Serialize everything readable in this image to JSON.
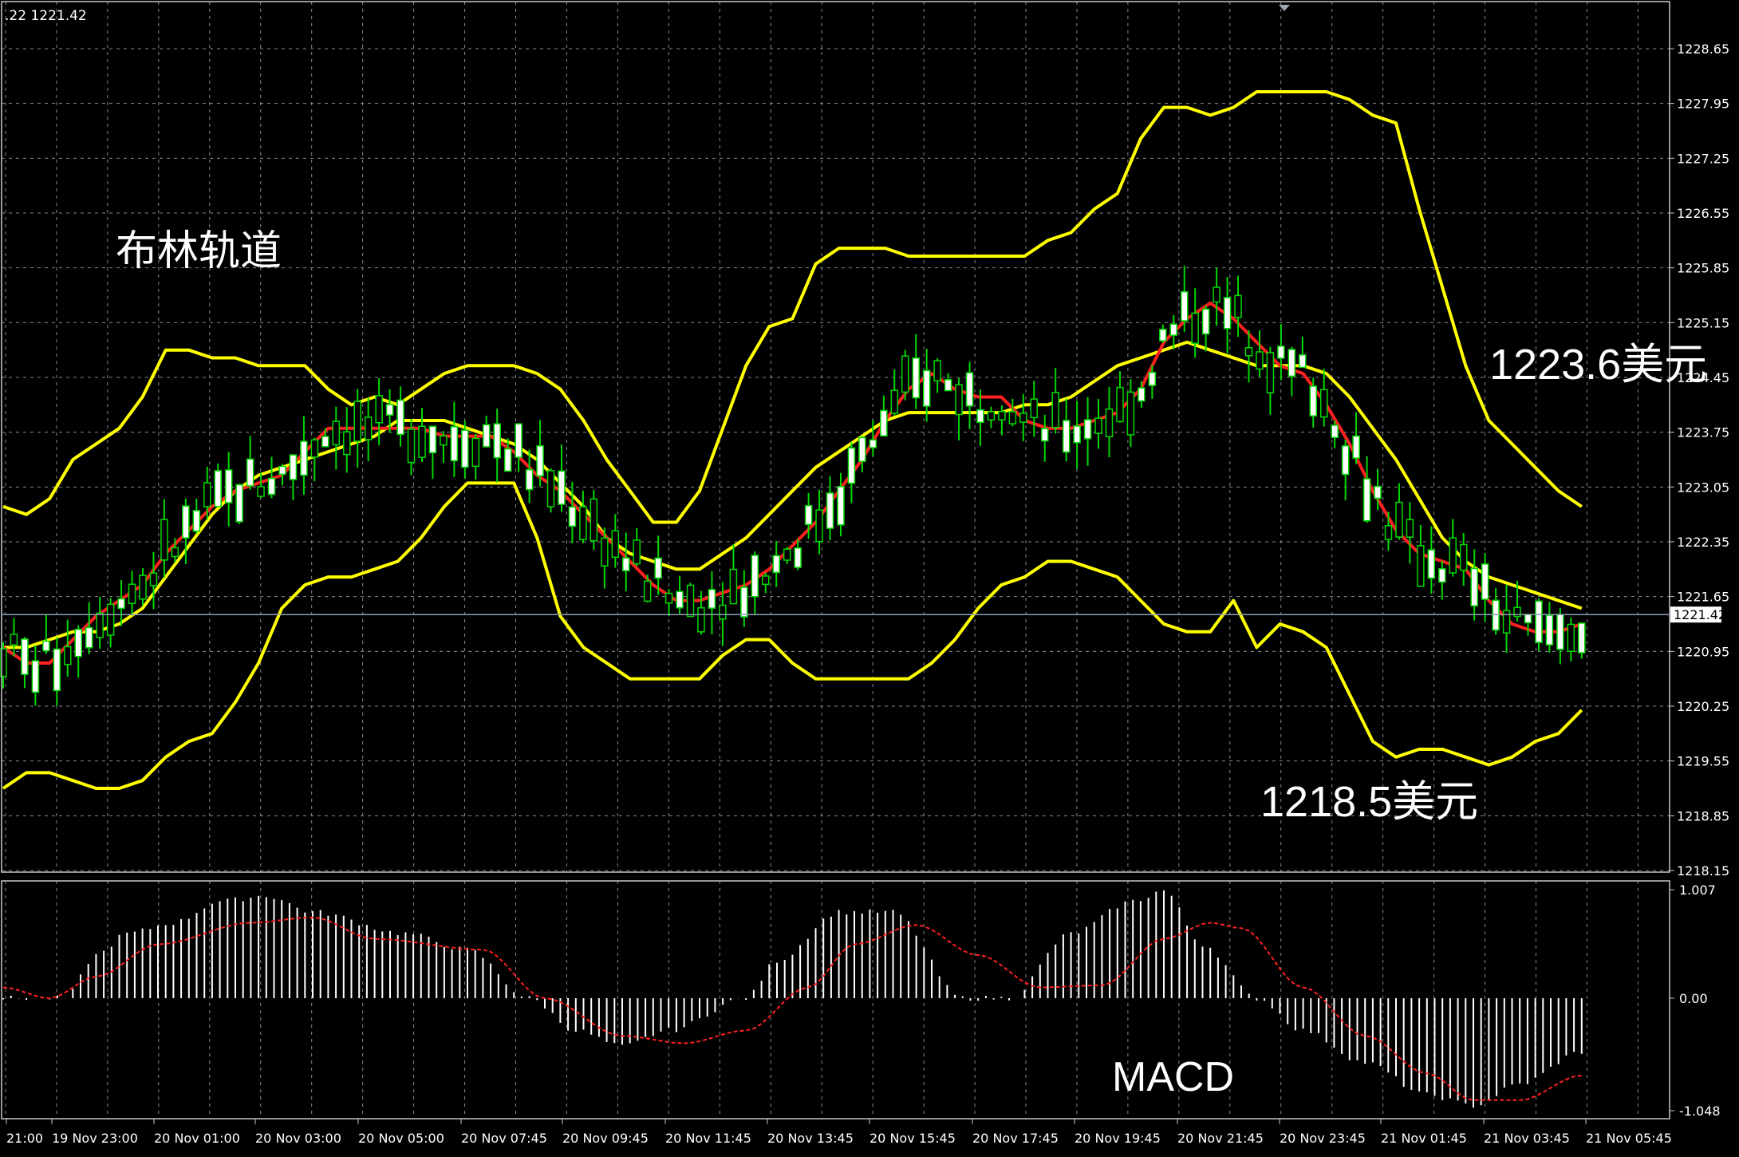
{
  "header": {
    "info": ".22 1221.42"
  },
  "annotations": {
    "title": "布林轨道",
    "upper": "1223.6美元",
    "lower": "1218.5美元",
    "macd": "MACD"
  },
  "colors": {
    "background": "#000000",
    "grid": "#8a8a8a",
    "candle": "#00d800",
    "bollinger": "#ffff00",
    "moving_average": "#ff2020",
    "macd_histogram": "#ffffff",
    "macd_signal": "#ff2020",
    "current_price_line": "#8ea0b4"
  },
  "chart_data": [
    {
      "type": "candlestick",
      "name": "price",
      "ylim": [
        1218.15,
        1228.65
      ],
      "y_ticks": [
        "1228.65",
        "1227.95",
        "1227.25",
        "1226.55",
        "1225.85",
        "1225.15",
        "1224.45",
        "1223.75",
        "1223.05",
        "1222.35",
        "1221.65",
        "1220.95",
        "1220.25",
        "1219.55",
        "1218.85",
        "1218.15"
      ],
      "current_price": "1221.42",
      "x_labels": [
        "21:00",
        "19 Nov 23:00",
        "20 Nov 01:00",
        "20 Nov 03:00",
        "20 Nov 05:00",
        "20 Nov 07:45",
        "20 Nov 09:45",
        "20 Nov 11:45",
        "20 Nov 13:45",
        "20 Nov 15:45",
        "20 Nov 17:45",
        "20 Nov 19:45",
        "20 Nov 21:45",
        "20 Nov 23:45",
        "21 Nov 01:45",
        "21 Nov 03:45",
        "21 Nov 05:45"
      ],
      "grid": true,
      "bollinger_upper": [
        [
          0,
          1222.8
        ],
        [
          3,
          1222.7
        ],
        [
          6,
          1222.9
        ],
        [
          9,
          1223.4
        ],
        [
          12,
          1223.6
        ],
        [
          15,
          1223.8
        ],
        [
          18,
          1224.2
        ],
        [
          21,
          1224.8
        ],
        [
          24,
          1224.8
        ],
        [
          27,
          1224.7
        ],
        [
          30,
          1224.7
        ],
        [
          33,
          1224.6
        ],
        [
          36,
          1224.6
        ],
        [
          39,
          1224.6
        ],
        [
          42,
          1224.3
        ],
        [
          45,
          1224.1
        ],
        [
          48,
          1224.2
        ],
        [
          51,
          1224.1
        ],
        [
          54,
          1224.3
        ],
        [
          57,
          1224.5
        ],
        [
          60,
          1224.6
        ],
        [
          63,
          1224.6
        ],
        [
          66,
          1224.6
        ],
        [
          69,
          1224.5
        ],
        [
          72,
          1224.3
        ],
        [
          75,
          1223.9
        ],
        [
          78,
          1223.4
        ],
        [
          81,
          1223.0
        ],
        [
          84,
          1222.6
        ],
        [
          87,
          1222.6
        ],
        [
          90,
          1223.0
        ],
        [
          93,
          1223.8
        ],
        [
          96,
          1224.6
        ],
        [
          99,
          1225.1
        ],
        [
          102,
          1225.2
        ],
        [
          105,
          1225.9
        ],
        [
          108,
          1226.1
        ],
        [
          111,
          1226.1
        ],
        [
          114,
          1226.1
        ],
        [
          117,
          1226.0
        ],
        [
          120,
          1226.0
        ],
        [
          123,
          1226.0
        ],
        [
          126,
          1226.0
        ],
        [
          129,
          1226.0
        ],
        [
          132,
          1226.0
        ],
        [
          135,
          1226.2
        ],
        [
          138,
          1226.3
        ],
        [
          141,
          1226.6
        ],
        [
          144,
          1226.8
        ],
        [
          147,
          1227.5
        ],
        [
          150,
          1227.9
        ],
        [
          153,
          1227.9
        ],
        [
          156,
          1227.8
        ],
        [
          159,
          1227.9
        ],
        [
          162,
          1228.1
        ],
        [
          165,
          1228.1
        ],
        [
          168,
          1228.1
        ],
        [
          171,
          1228.1
        ],
        [
          174,
          1228.0
        ],
        [
          177,
          1227.8
        ],
        [
          180,
          1227.7
        ],
        [
          183,
          1226.6
        ],
        [
          186,
          1225.6
        ],
        [
          189,
          1224.6
        ],
        [
          192,
          1223.9
        ],
        [
          195,
          1223.6
        ],
        [
          198,
          1223.3
        ],
        [
          201,
          1223.0
        ],
        [
          204,
          1222.8
        ]
      ],
      "bollinger_middle": [
        [
          0,
          1221.0
        ],
        [
          3,
          1221.0
        ],
        [
          6,
          1221.1
        ],
        [
          9,
          1221.2
        ],
        [
          12,
          1221.2
        ],
        [
          15,
          1221.3
        ],
        [
          18,
          1221.5
        ],
        [
          21,
          1221.9
        ],
        [
          24,
          1222.3
        ],
        [
          27,
          1222.7
        ],
        [
          30,
          1223.0
        ],
        [
          33,
          1223.2
        ],
        [
          36,
          1223.3
        ],
        [
          39,
          1223.4
        ],
        [
          42,
          1223.5
        ],
        [
          45,
          1223.6
        ],
        [
          48,
          1223.7
        ],
        [
          51,
          1223.9
        ],
        [
          54,
          1223.9
        ],
        [
          57,
          1223.9
        ],
        [
          60,
          1223.8
        ],
        [
          63,
          1223.7
        ],
        [
          66,
          1223.6
        ],
        [
          69,
          1223.4
        ],
        [
          72,
          1223.1
        ],
        [
          75,
          1222.8
        ],
        [
          78,
          1222.4
        ],
        [
          81,
          1222.2
        ],
        [
          84,
          1222.1
        ],
        [
          87,
          1222.0
        ],
        [
          90,
          1222.0
        ],
        [
          93,
          1222.2
        ],
        [
          96,
          1222.4
        ],
        [
          99,
          1222.7
        ],
        [
          102,
          1223.0
        ],
        [
          105,
          1223.3
        ],
        [
          108,
          1223.5
        ],
        [
          111,
          1223.7
        ],
        [
          114,
          1223.9
        ],
        [
          117,
          1224.0
        ],
        [
          120,
          1224.0
        ],
        [
          123,
          1224.0
        ],
        [
          126,
          1224.0
        ],
        [
          129,
          1224.0
        ],
        [
          132,
          1224.1
        ],
        [
          135,
          1224.1
        ],
        [
          138,
          1224.2
        ],
        [
          141,
          1224.4
        ],
        [
          144,
          1224.6
        ],
        [
          147,
          1224.7
        ],
        [
          150,
          1224.8
        ],
        [
          153,
          1224.9
        ],
        [
          156,
          1224.8
        ],
        [
          159,
          1224.7
        ],
        [
          162,
          1224.6
        ],
        [
          165,
          1224.6
        ],
        [
          168,
          1224.6
        ],
        [
          171,
          1224.5
        ],
        [
          174,
          1224.2
        ],
        [
          177,
          1223.8
        ],
        [
          180,
          1223.4
        ],
        [
          183,
          1222.9
        ],
        [
          186,
          1222.4
        ],
        [
          189,
          1222.1
        ],
        [
          192,
          1221.9
        ],
        [
          195,
          1221.8
        ],
        [
          198,
          1221.7
        ],
        [
          201,
          1221.6
        ],
        [
          204,
          1221.5
        ]
      ],
      "bollinger_lower": [
        [
          0,
          1219.2
        ],
        [
          3,
          1219.4
        ],
        [
          6,
          1219.4
        ],
        [
          9,
          1219.3
        ],
        [
          12,
          1219.2
        ],
        [
          15,
          1219.2
        ],
        [
          18,
          1219.3
        ],
        [
          21,
          1219.6
        ],
        [
          24,
          1219.8
        ],
        [
          27,
          1219.9
        ],
        [
          30,
          1220.3
        ],
        [
          33,
          1220.8
        ],
        [
          36,
          1221.5
        ],
        [
          39,
          1221.8
        ],
        [
          42,
          1221.9
        ],
        [
          45,
          1221.9
        ],
        [
          48,
          1222.0
        ],
        [
          51,
          1222.1
        ],
        [
          54,
          1222.4
        ],
        [
          57,
          1222.8
        ],
        [
          60,
          1223.1
        ],
        [
          63,
          1223.1
        ],
        [
          66,
          1223.1
        ],
        [
          69,
          1222.4
        ],
        [
          72,
          1221.4
        ],
        [
          75,
          1221.0
        ],
        [
          78,
          1220.8
        ],
        [
          81,
          1220.6
        ],
        [
          84,
          1220.6
        ],
        [
          87,
          1220.6
        ],
        [
          90,
          1220.6
        ],
        [
          93,
          1220.9
        ],
        [
          96,
          1221.1
        ],
        [
          99,
          1221.1
        ],
        [
          102,
          1220.8
        ],
        [
          105,
          1220.6
        ],
        [
          108,
          1220.6
        ],
        [
          111,
          1220.6
        ],
        [
          114,
          1220.6
        ],
        [
          117,
          1220.6
        ],
        [
          120,
          1220.8
        ],
        [
          123,
          1221.1
        ],
        [
          126,
          1221.5
        ],
        [
          129,
          1221.8
        ],
        [
          132,
          1221.9
        ],
        [
          135,
          1222.1
        ],
        [
          138,
          1222.1
        ],
        [
          141,
          1222.0
        ],
        [
          144,
          1221.9
        ],
        [
          147,
          1221.6
        ],
        [
          150,
          1221.3
        ],
        [
          153,
          1221.2
        ],
        [
          156,
          1221.2
        ],
        [
          159,
          1221.6
        ],
        [
          162,
          1221.0
        ],
        [
          165,
          1221.3
        ],
        [
          168,
          1221.2
        ],
        [
          171,
          1221.0
        ],
        [
          174,
          1220.4
        ],
        [
          177,
          1219.8
        ],
        [
          180,
          1219.6
        ],
        [
          183,
          1219.7
        ],
        [
          186,
          1219.7
        ],
        [
          189,
          1219.6
        ],
        [
          192,
          1219.5
        ],
        [
          195,
          1219.6
        ],
        [
          198,
          1219.8
        ],
        [
          201,
          1219.9
        ],
        [
          204,
          1220.2
        ]
      ],
      "moving_average": [
        [
          0,
          1221.0
        ],
        [
          3,
          1220.8
        ],
        [
          6,
          1220.8
        ],
        [
          9,
          1221.1
        ],
        [
          12,
          1221.4
        ],
        [
          15,
          1221.6
        ],
        [
          18,
          1221.8
        ],
        [
          21,
          1222.2
        ],
        [
          24,
          1222.5
        ],
        [
          27,
          1222.8
        ],
        [
          30,
          1223.0
        ],
        [
          33,
          1223.1
        ],
        [
          36,
          1223.2
        ],
        [
          39,
          1223.5
        ],
        [
          42,
          1223.8
        ],
        [
          45,
          1223.8
        ],
        [
          48,
          1223.8
        ],
        [
          51,
          1223.8
        ],
        [
          54,
          1223.8
        ],
        [
          57,
          1223.7
        ],
        [
          60,
          1223.7
        ],
        [
          63,
          1223.7
        ],
        [
          66,
          1223.5
        ],
        [
          69,
          1223.2
        ],
        [
          72,
          1223.0
        ],
        [
          75,
          1222.7
        ],
        [
          78,
          1222.4
        ],
        [
          81,
          1222.1
        ],
        [
          84,
          1221.8
        ],
        [
          87,
          1221.6
        ],
        [
          90,
          1221.6
        ],
        [
          93,
          1221.7
        ],
        [
          96,
          1221.8
        ],
        [
          99,
          1222.0
        ],
        [
          102,
          1222.3
        ],
        [
          105,
          1222.6
        ],
        [
          108,
          1223.0
        ],
        [
          111,
          1223.4
        ],
        [
          114,
          1223.9
        ],
        [
          117,
          1224.3
        ],
        [
          120,
          1224.5
        ],
        [
          123,
          1224.3
        ],
        [
          126,
          1224.2
        ],
        [
          129,
          1224.2
        ],
        [
          132,
          1223.9
        ],
        [
          135,
          1223.8
        ],
        [
          138,
          1223.8
        ],
        [
          141,
          1223.9
        ],
        [
          144,
          1224.0
        ],
        [
          147,
          1224.3
        ],
        [
          150,
          1224.9
        ],
        [
          153,
          1225.2
        ],
        [
          156,
          1225.4
        ],
        [
          159,
          1225.2
        ],
        [
          162,
          1224.9
        ],
        [
          165,
          1224.6
        ],
        [
          168,
          1224.5
        ],
        [
          171,
          1224.1
        ],
        [
          174,
          1223.6
        ],
        [
          177,
          1223.0
        ],
        [
          180,
          1222.5
        ],
        [
          183,
          1222.2
        ],
        [
          186,
          1222.1
        ],
        [
          189,
          1222.0
        ],
        [
          192,
          1221.6
        ],
        [
          195,
          1221.3
        ],
        [
          198,
          1221.2
        ],
        [
          201,
          1221.2
        ],
        [
          204,
          1221.3
        ]
      ]
    },
    {
      "type": "bar",
      "name": "MACD",
      "ylim": [
        -1.048,
        1.007
      ],
      "y_ticks": [
        "1.007",
        "0.00",
        "-1.048"
      ],
      "histogram_keyframes": [
        [
          0,
          0.0
        ],
        [
          8,
          0.0
        ],
        [
          12,
          0.4
        ],
        [
          16,
          0.6
        ],
        [
          22,
          0.7
        ],
        [
          28,
          0.9
        ],
        [
          34,
          0.95
        ],
        [
          40,
          0.8
        ],
        [
          52,
          0.6
        ],
        [
          60,
          0.45
        ],
        [
          68,
          0.0
        ],
        [
          74,
          -0.3
        ],
        [
          80,
          -0.45
        ],
        [
          86,
          -0.3
        ],
        [
          96,
          0.0
        ],
        [
          100,
          0.35
        ],
        [
          108,
          0.8
        ],
        [
          115,
          0.8
        ],
        [
          124,
          0.0
        ],
        [
          130,
          0.0
        ],
        [
          138,
          0.6
        ],
        [
          146,
          0.9
        ],
        [
          150,
          1.0
        ],
        [
          155,
          0.5
        ],
        [
          162,
          0.0
        ],
        [
          168,
          -0.3
        ],
        [
          176,
          -0.6
        ],
        [
          184,
          -0.9
        ],
        [
          190,
          -1.0
        ],
        [
          196,
          -0.8
        ],
        [
          204,
          -0.5
        ]
      ],
      "signal_keyframes": [
        [
          0,
          0.1
        ],
        [
          6,
          0.0
        ],
        [
          12,
          0.2
        ],
        [
          20,
          0.5
        ],
        [
          32,
          0.7
        ],
        [
          40,
          0.75
        ],
        [
          48,
          0.55
        ],
        [
          62,
          0.45
        ],
        [
          70,
          0.0
        ],
        [
          80,
          -0.35
        ],
        [
          88,
          -0.42
        ],
        [
          96,
          -0.3
        ],
        [
          104,
          0.1
        ],
        [
          110,
          0.5
        ],
        [
          118,
          0.68
        ],
        [
          126,
          0.4
        ],
        [
          134,
          0.1
        ],
        [
          142,
          0.12
        ],
        [
          150,
          0.55
        ],
        [
          156,
          0.7
        ],
        [
          160,
          0.65
        ],
        [
          168,
          0.1
        ],
        [
          176,
          -0.35
        ],
        [
          184,
          -0.7
        ],
        [
          190,
          -0.95
        ],
        [
          196,
          -0.95
        ],
        [
          204,
          -0.72
        ]
      ]
    }
  ]
}
